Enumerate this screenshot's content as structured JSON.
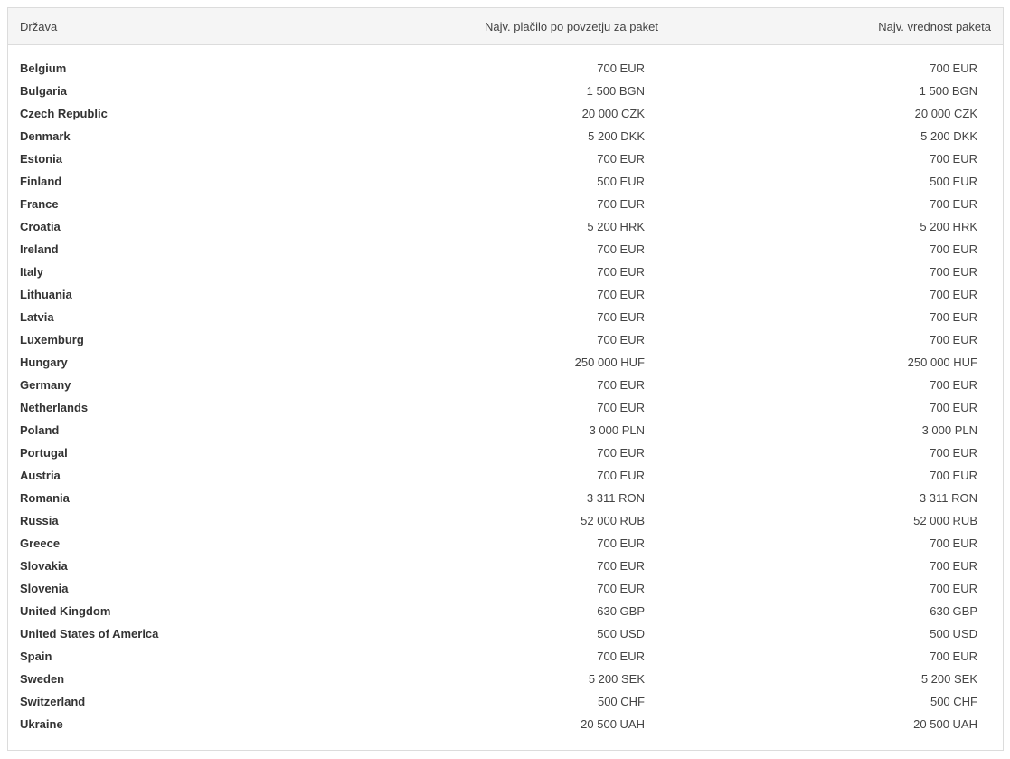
{
  "table": {
    "headers": {
      "country": "Država",
      "max_payment": "Najv. plačilo po povzetju za paket",
      "max_value": "Najv. vrednost paketa"
    },
    "rows": [
      {
        "country": "Belgium",
        "max_payment": "700 EUR",
        "max_value": "700 EUR"
      },
      {
        "country": "Bulgaria",
        "max_payment": "1 500 BGN",
        "max_value": "1 500 BGN"
      },
      {
        "country": "Czech Republic",
        "max_payment": "20 000 CZK",
        "max_value": "20 000 CZK"
      },
      {
        "country": "Denmark",
        "max_payment": "5 200 DKK",
        "max_value": "5 200 DKK"
      },
      {
        "country": "Estonia",
        "max_payment": "700 EUR",
        "max_value": "700 EUR"
      },
      {
        "country": "Finland",
        "max_payment": "500 EUR",
        "max_value": "500 EUR"
      },
      {
        "country": "France",
        "max_payment": "700 EUR",
        "max_value": "700 EUR"
      },
      {
        "country": "Croatia",
        "max_payment": "5 200 HRK",
        "max_value": "5 200 HRK"
      },
      {
        "country": "Ireland",
        "max_payment": "700 EUR",
        "max_value": "700 EUR"
      },
      {
        "country": "Italy",
        "max_payment": "700 EUR",
        "max_value": "700 EUR"
      },
      {
        "country": "Lithuania",
        "max_payment": "700 EUR",
        "max_value": "700 EUR"
      },
      {
        "country": "Latvia",
        "max_payment": "700 EUR",
        "max_value": "700 EUR"
      },
      {
        "country": "Luxemburg",
        "max_payment": "700 EUR",
        "max_value": "700 EUR"
      },
      {
        "country": "Hungary",
        "max_payment": "250 000 HUF",
        "max_value": "250 000 HUF"
      },
      {
        "country": "Germany",
        "max_payment": "700 EUR",
        "max_value": "700 EUR"
      },
      {
        "country": "Netherlands",
        "max_payment": "700 EUR",
        "max_value": "700 EUR"
      },
      {
        "country": "Poland",
        "max_payment": "3 000 PLN",
        "max_value": "3 000 PLN"
      },
      {
        "country": "Portugal",
        "max_payment": "700 EUR",
        "max_value": "700 EUR"
      },
      {
        "country": "Austria",
        "max_payment": "700 EUR",
        "max_value": "700 EUR"
      },
      {
        "country": "Romania",
        "max_payment": "3 311 RON",
        "max_value": "3 311 RON"
      },
      {
        "country": "Russia",
        "max_payment": "52 000 RUB",
        "max_value": "52 000 RUB"
      },
      {
        "country": "Greece",
        "max_payment": "700 EUR",
        "max_value": "700 EUR"
      },
      {
        "country": "Slovakia",
        "max_payment": "700 EUR",
        "max_value": "700 EUR"
      },
      {
        "country": "Slovenia",
        "max_payment": "700 EUR",
        "max_value": "700 EUR"
      },
      {
        "country": "United Kingdom",
        "max_payment": "630 GBP",
        "max_value": "630 GBP"
      },
      {
        "country": "United States of America",
        "max_payment": "500 USD",
        "max_value": "500 USD"
      },
      {
        "country": "Spain",
        "max_payment": "700 EUR",
        "max_value": "700 EUR"
      },
      {
        "country": "Sweden",
        "max_payment": "5 200 SEK",
        "max_value": "5 200 SEK"
      },
      {
        "country": "Switzerland",
        "max_payment": "500 CHF",
        "max_value": "500 CHF"
      },
      {
        "country": "Ukraine",
        "max_payment": "20 500 UAH",
        "max_value": "20 500 UAH"
      }
    ]
  }
}
